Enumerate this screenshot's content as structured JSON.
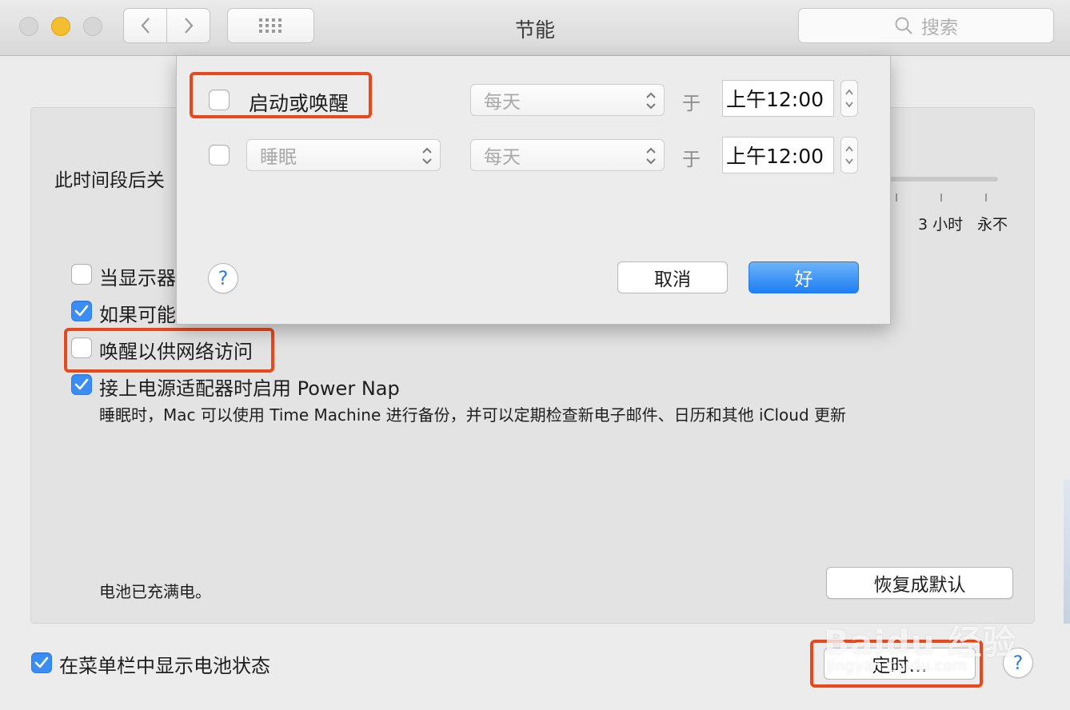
{
  "window": {
    "title": "节能"
  },
  "search": {
    "placeholder": "搜索"
  },
  "main": {
    "sleep_label": "此时间段后关",
    "slider_ticks": [
      "3 小时",
      "永不"
    ],
    "options": [
      {
        "label": "当显示器",
        "checked": false
      },
      {
        "label": "如果可能",
        "checked": true
      },
      {
        "label": "唤醒以供网络访问",
        "checked": false
      },
      {
        "label": "接上电源适配器时启用 Power Nap",
        "checked": true
      }
    ],
    "powernap_description": "睡眠时，Mac 可以使用 Time Machine 进行备份，并可以定期检查新电子邮件、日历和其他 iCloud 更新",
    "battery_status": "电池已充满电。",
    "restore_defaults_label": "恢复成默认",
    "show_battery_label": "在菜单栏中显示电池状态",
    "show_battery_checked": true,
    "schedule_label": "定时…",
    "help_label": "?"
  },
  "schedule_sheet": {
    "row1": {
      "checked": false,
      "label": "启动或唤醒",
      "repeat": "每天",
      "at": "于",
      "time": "上午12:00"
    },
    "row2": {
      "checked": false,
      "action": "睡眠",
      "repeat": "每天",
      "at": "于",
      "time": "上午12:00"
    },
    "help_label": "?",
    "cancel_label": "取消",
    "ok_label": "好"
  },
  "watermark": {
    "logo_text": "Baidu 经验",
    "url": "jingyan.baidu.com"
  },
  "colors": {
    "accent": "#3a8df5",
    "highlight_box": "#e8481c",
    "ok_button": "#1f7ff3"
  }
}
